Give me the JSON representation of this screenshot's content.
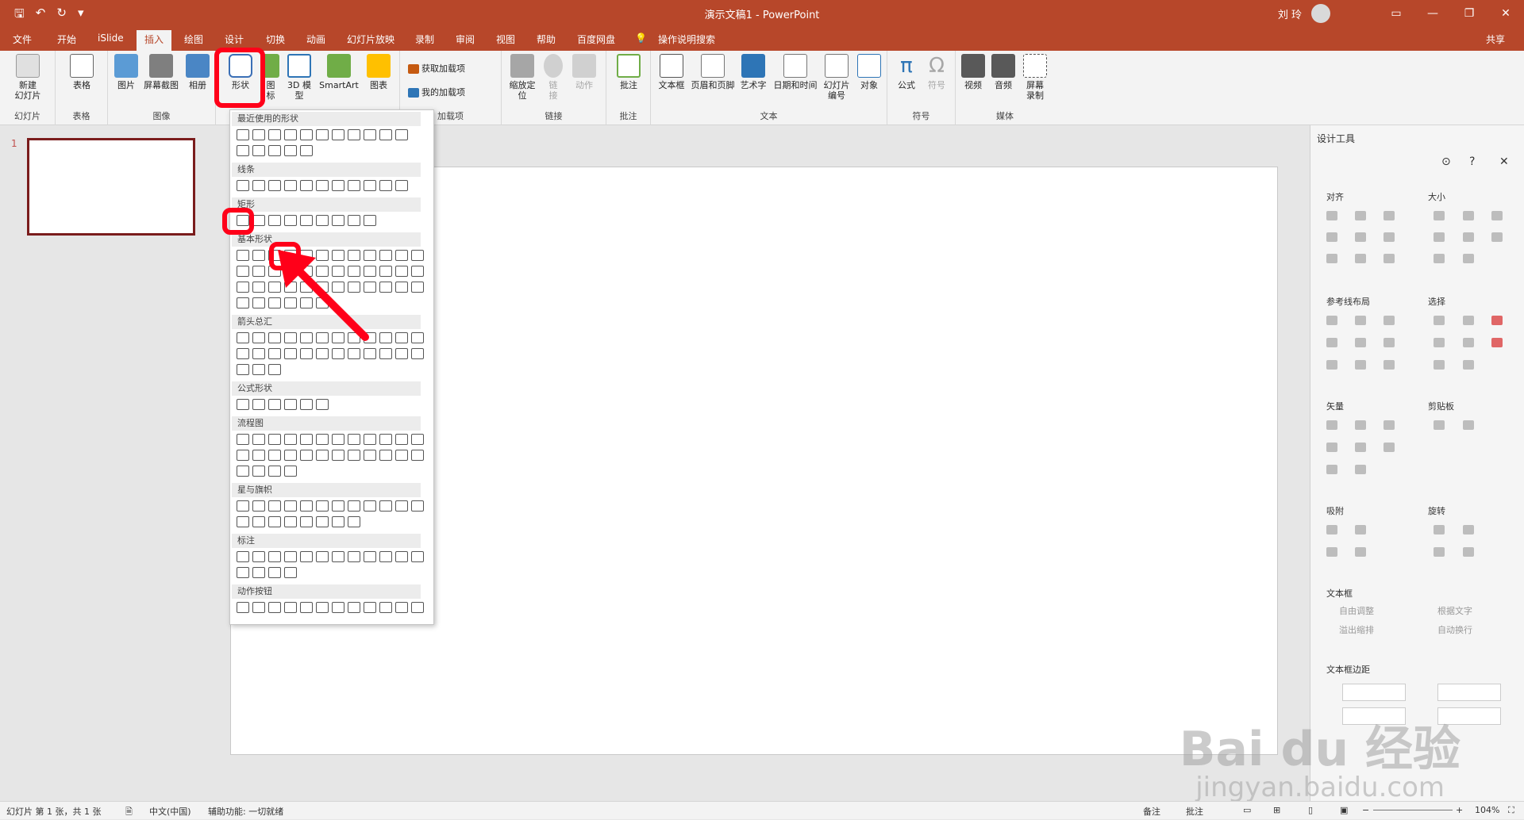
{
  "window": {
    "title": "演示文稿1  -  PowerPoint",
    "user": "刘 玲"
  },
  "tabs": [
    {
      "label": "文件"
    },
    {
      "label": "开始"
    },
    {
      "label": "iSlide"
    },
    {
      "label": "插入"
    },
    {
      "label": "绘图"
    },
    {
      "label": "设计"
    },
    {
      "label": "切换"
    },
    {
      "label": "动画"
    },
    {
      "label": "幻灯片放映"
    },
    {
      "label": "录制"
    },
    {
      "label": "审阅"
    },
    {
      "label": "视图"
    },
    {
      "label": "帮助"
    },
    {
      "label": "百度网盘"
    },
    {
      "label": "操作说明搜索"
    }
  ],
  "share": "共享",
  "ribbon": {
    "new_slide": "新建\n幻灯片",
    "slides_group": "幻灯片",
    "table": "表格",
    "table_group": "表格",
    "picture": "图片",
    "screenshot": "屏幕截图",
    "album": "相册",
    "image_group": "图像",
    "shapes": "形状",
    "icons": "图\n标",
    "model3d": "3D 模\n型",
    "smartart": "SmartArt",
    "chart": "图表",
    "get_addins": "获取加载项",
    "my_addins": "我的加载项",
    "addins_group": "加载项",
    "zoom": "缩放定\n位",
    "link": "链\n接",
    "action": "动作",
    "links_group": "链接",
    "comment": "批注",
    "comment_group": "批注",
    "textbox": "文本框",
    "header_footer": "页眉和页脚",
    "wordart": "艺术字",
    "datetime": "日期和时间",
    "slide_num": "幻灯片\n编号",
    "object": "对象",
    "text_group": "文本",
    "equation": "公式",
    "symbol": "符号",
    "symbol_group": "符号",
    "video": "视频",
    "audio": "音频",
    "screen_record": "屏幕\n录制",
    "media_group": "媒体"
  },
  "slide_panel": {
    "number": "1"
  },
  "shapes_dropdown": {
    "sections": [
      "最近使用的形状",
      "线条",
      "矩形",
      "基本形状",
      "箭头总汇",
      "公式形状",
      "流程图",
      "星与旗帜",
      "标注",
      "动作按钮"
    ]
  },
  "design_panel": {
    "title": "设计工具",
    "align": "对齐",
    "size": "大小",
    "guides": "参考线布局",
    "select": "选择",
    "vector": "矢量",
    "clipboard": "剪贴板",
    "snap": "吸附",
    "rotate": "旋转",
    "textbox": "文本框",
    "auto_fit": "自由调整",
    "fit_text": "根据文字",
    "overflow": "溢出缩排",
    "auto_wrap": "自动换行",
    "margin": "文本框边距"
  },
  "status": {
    "slide_info": "幻灯片 第 1 张，共 1 张",
    "language": "中文(中国)",
    "accessibility": "辅助功能: 一切就绪",
    "notes": "备注",
    "comments": "批注",
    "zoom": "104%"
  },
  "watermark": {
    "logo": "Bai du 经验",
    "url": "jingyan.baidu.com"
  },
  "colors": {
    "accent": "#b7472a",
    "highlight": "#ff0019"
  }
}
